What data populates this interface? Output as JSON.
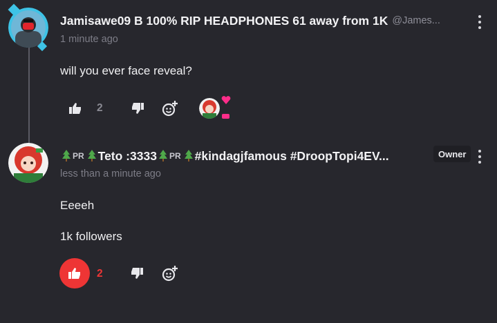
{
  "comment1": {
    "username": "Jamisawe09 B 100% RIP HEADPHONES 61 away from 1K",
    "handle": "@James...",
    "timestamp": "1 minute ago",
    "text": "will you ever face reveal?",
    "like_count": "2"
  },
  "comment2": {
    "name_parts": [
      "PR",
      "Teto :3333",
      "PR",
      "#kindagjfamous #DroopTopi4EV..."
    ],
    "badge": "Owner",
    "timestamp": "less than a minute ago",
    "lines": [
      "Eeeeh",
      "1k followers"
    ],
    "like_count": "2",
    "liked": true
  },
  "colors": {
    "background": "#27272d",
    "like_active": "#ee3535",
    "heart": "#ff2d8a"
  }
}
